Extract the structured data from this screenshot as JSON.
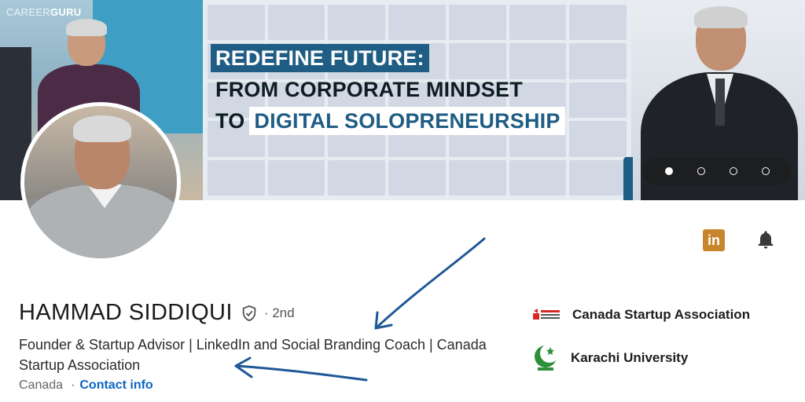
{
  "banner": {
    "brand_1": "CAREER",
    "brand_2": "GURU",
    "headline_line1": "REDEFINE FUTURE:",
    "headline_line2": "FROM CORPORATE MINDSET",
    "headline_line3_prefix": "TO",
    "headline_line3_highlight": "DIGITAL SOLOPRENEURSHIP",
    "carousel": {
      "total": 4,
      "active_index": 0
    },
    "colors": {
      "accent": "#1f5d84",
      "zoom_bg": "#eef1f6"
    }
  },
  "profile": {
    "name": "HAMMAD SIDDIQUI",
    "degree": "· 2nd",
    "headline": "Founder & Startup Advisor | LinkedIn and Social Branding Coach | Canada Startup Association",
    "location": "Canada",
    "separator": "·",
    "contact_label": "Contact info",
    "verified_icon": "shield-check-icon"
  },
  "side": {
    "org1_name": "Canada Startup Association",
    "org2_name": "Karachi University",
    "org1_logo": "canada-startup-association-logo",
    "org2_logo": "karachi-university-crescent-logo"
  },
  "icons": {
    "linkedin_label": "in",
    "bell": "bell-icon",
    "linkedin_color": "#c8862c"
  },
  "annotations": {
    "arrow_color": "#1f5896"
  }
}
